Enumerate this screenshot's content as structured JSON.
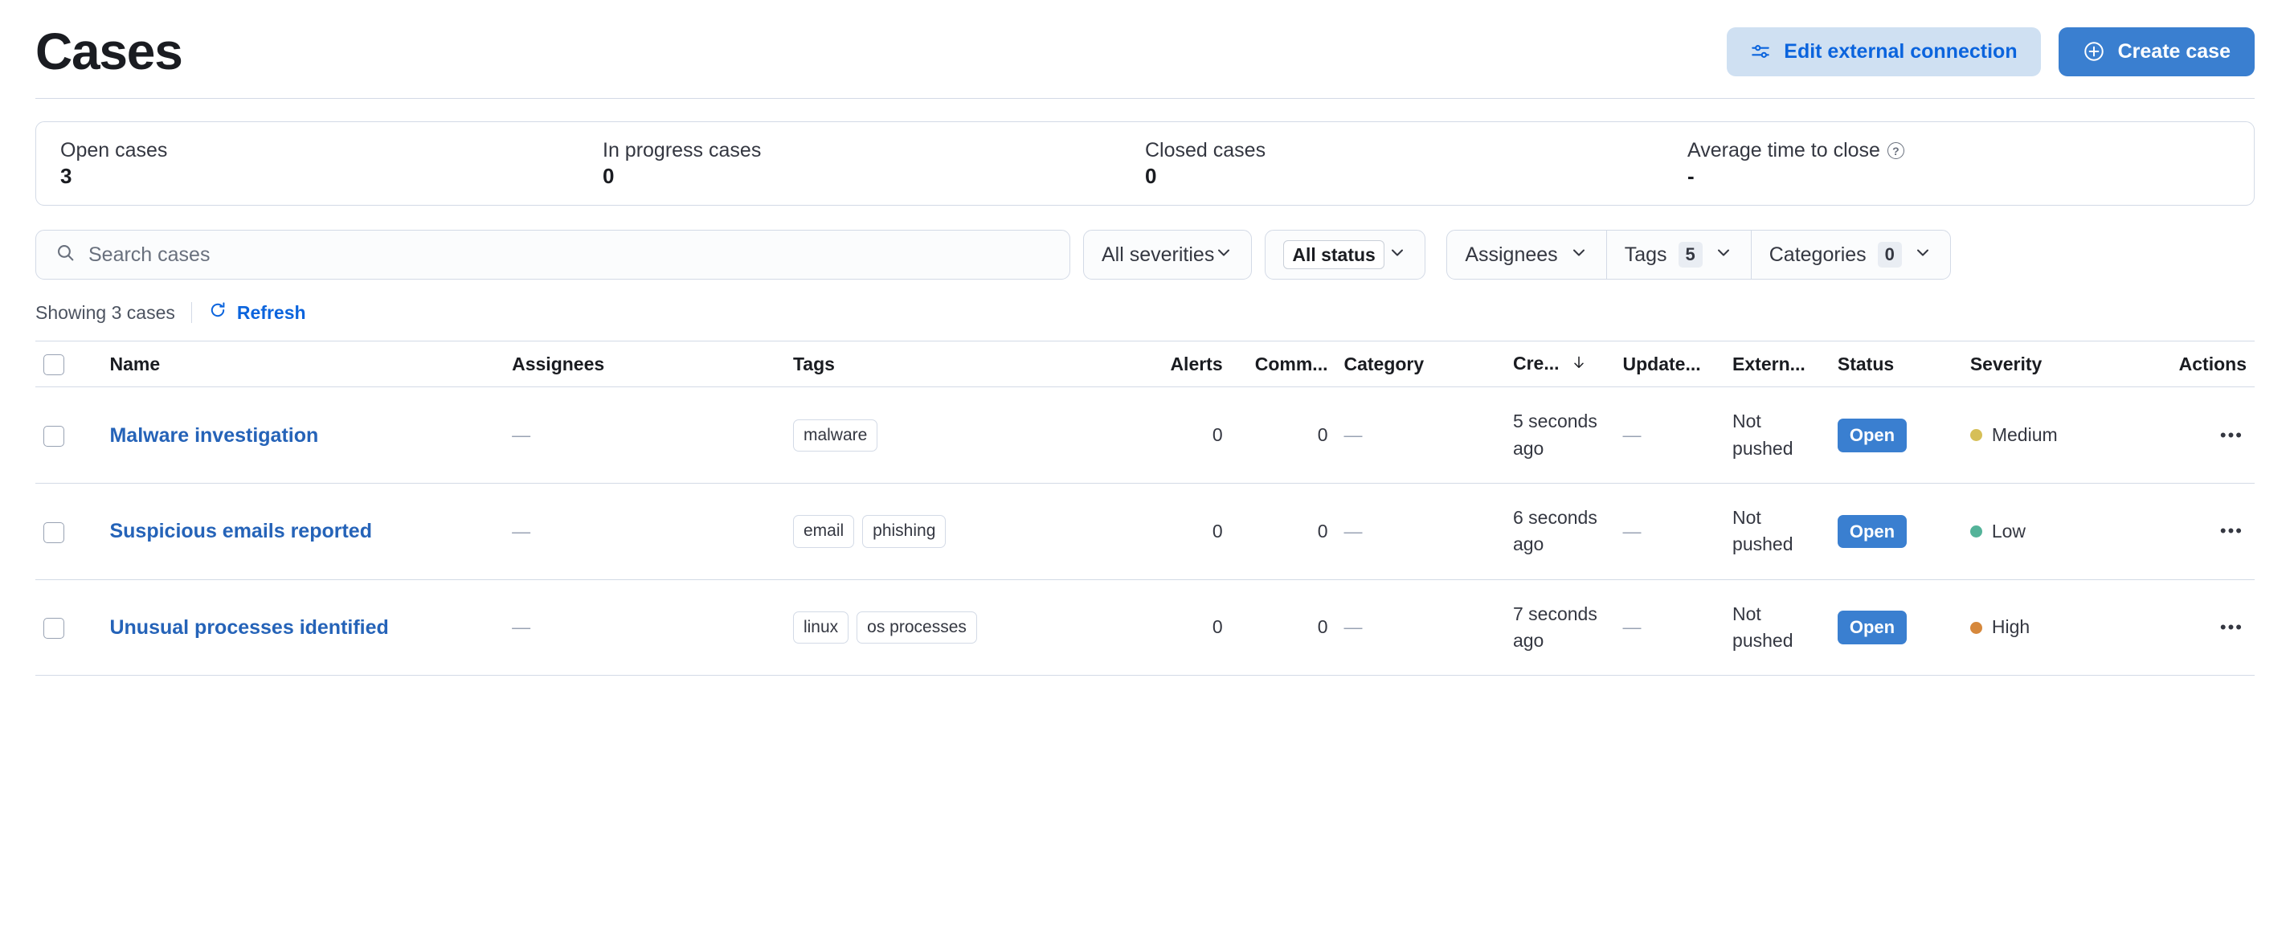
{
  "header": {
    "title": "Cases",
    "edit_connection_label": "Edit external connection",
    "create_case_label": "Create case"
  },
  "stats": [
    {
      "label": "Open cases",
      "value": "3",
      "has_help": false
    },
    {
      "label": "In progress cases",
      "value": "0",
      "has_help": false
    },
    {
      "label": "Closed cases",
      "value": "0",
      "has_help": false
    },
    {
      "label": "Average time to close",
      "value": "-",
      "has_help": true
    }
  ],
  "filters": {
    "search_placeholder": "Search cases",
    "search_value": "",
    "severity_label": "All severities",
    "status_label": "All status",
    "assignees_label": "Assignees",
    "tags_label": "Tags",
    "tags_count": "5",
    "categories_label": "Categories",
    "categories_count": "0"
  },
  "toolbar": {
    "showing_text": "Showing 3 cases",
    "refresh_label": "Refresh"
  },
  "table": {
    "columns": [
      "Name",
      "Assignees",
      "Tags",
      "Alerts",
      "Comm...",
      "Category",
      "Cre...",
      "Update...",
      "Extern...",
      "Status",
      "Severity",
      "Actions"
    ],
    "sorted_column": "Cre...",
    "sort_direction": "desc",
    "rows": [
      {
        "name": "Malware investigation",
        "assignees": "—",
        "tags": [
          "malware"
        ],
        "alerts": "0",
        "comments": "0",
        "category": "—",
        "created": "5 seconds ago",
        "updated": "—",
        "external": "Not pushed",
        "status": "Open",
        "severity": "Medium",
        "severity_color": "#d6bf57",
        "actions": "•••"
      },
      {
        "name": "Suspicious emails reported",
        "assignees": "—",
        "tags": [
          "email",
          "phishing"
        ],
        "alerts": "0",
        "comments": "0",
        "category": "—",
        "created": "6 seconds ago",
        "updated": "—",
        "external": "Not pushed",
        "status": "Open",
        "severity": "Low",
        "severity_color": "#54b399",
        "actions": "•••"
      },
      {
        "name": "Unusual processes identified",
        "assignees": "—",
        "tags": [
          "linux",
          "os processes"
        ],
        "alerts": "0",
        "comments": "0",
        "category": "—",
        "created": "7 seconds ago",
        "updated": "—",
        "external": "Not pushed",
        "status": "Open",
        "severity": "High",
        "severity_color": "#d6883c",
        "actions": "•••"
      }
    ]
  },
  "colors": {
    "primary": "#3a7fd0",
    "link": "#2563b8",
    "secondary_bg": "#cfe0f2",
    "border": "#d3dae6"
  }
}
